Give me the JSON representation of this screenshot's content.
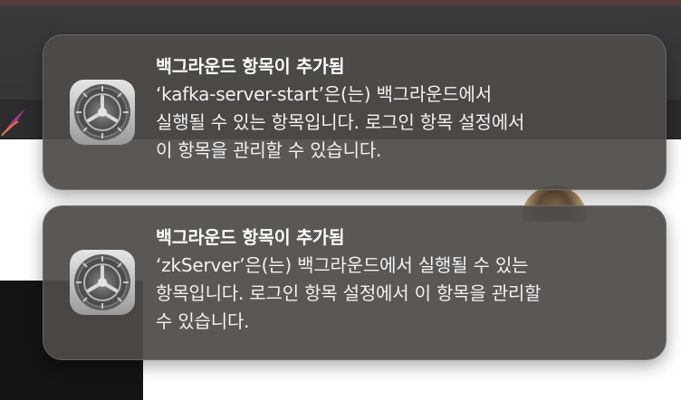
{
  "notifications": [
    {
      "app_icon": "system-settings-gear-icon",
      "title": "백그라운드 항목이 추가됨",
      "body_lines": [
        "‘kafka-server-start’은(는) 백그라운드에서",
        "실행될 수 있는 항목입니다. 로그인 항목 설정에서",
        "이 항목을 관리할 수 있습니다."
      ]
    },
    {
      "app_icon": "system-settings-gear-icon",
      "title": "백그라운드 항목이 추가됨",
      "body_lines": [
        "‘zkServer’은(는) 백그라운드에서 실행될 수 있는",
        "항목입니다. 로그인 항목 설정에서 이 항목을 관리할",
        "수 있습니다."
      ]
    }
  ],
  "colors": {
    "notification_bg": "#4e4a48",
    "text": "#ffffff",
    "window_bg_dark": "#363538",
    "content_bg": "#ffffff"
  }
}
